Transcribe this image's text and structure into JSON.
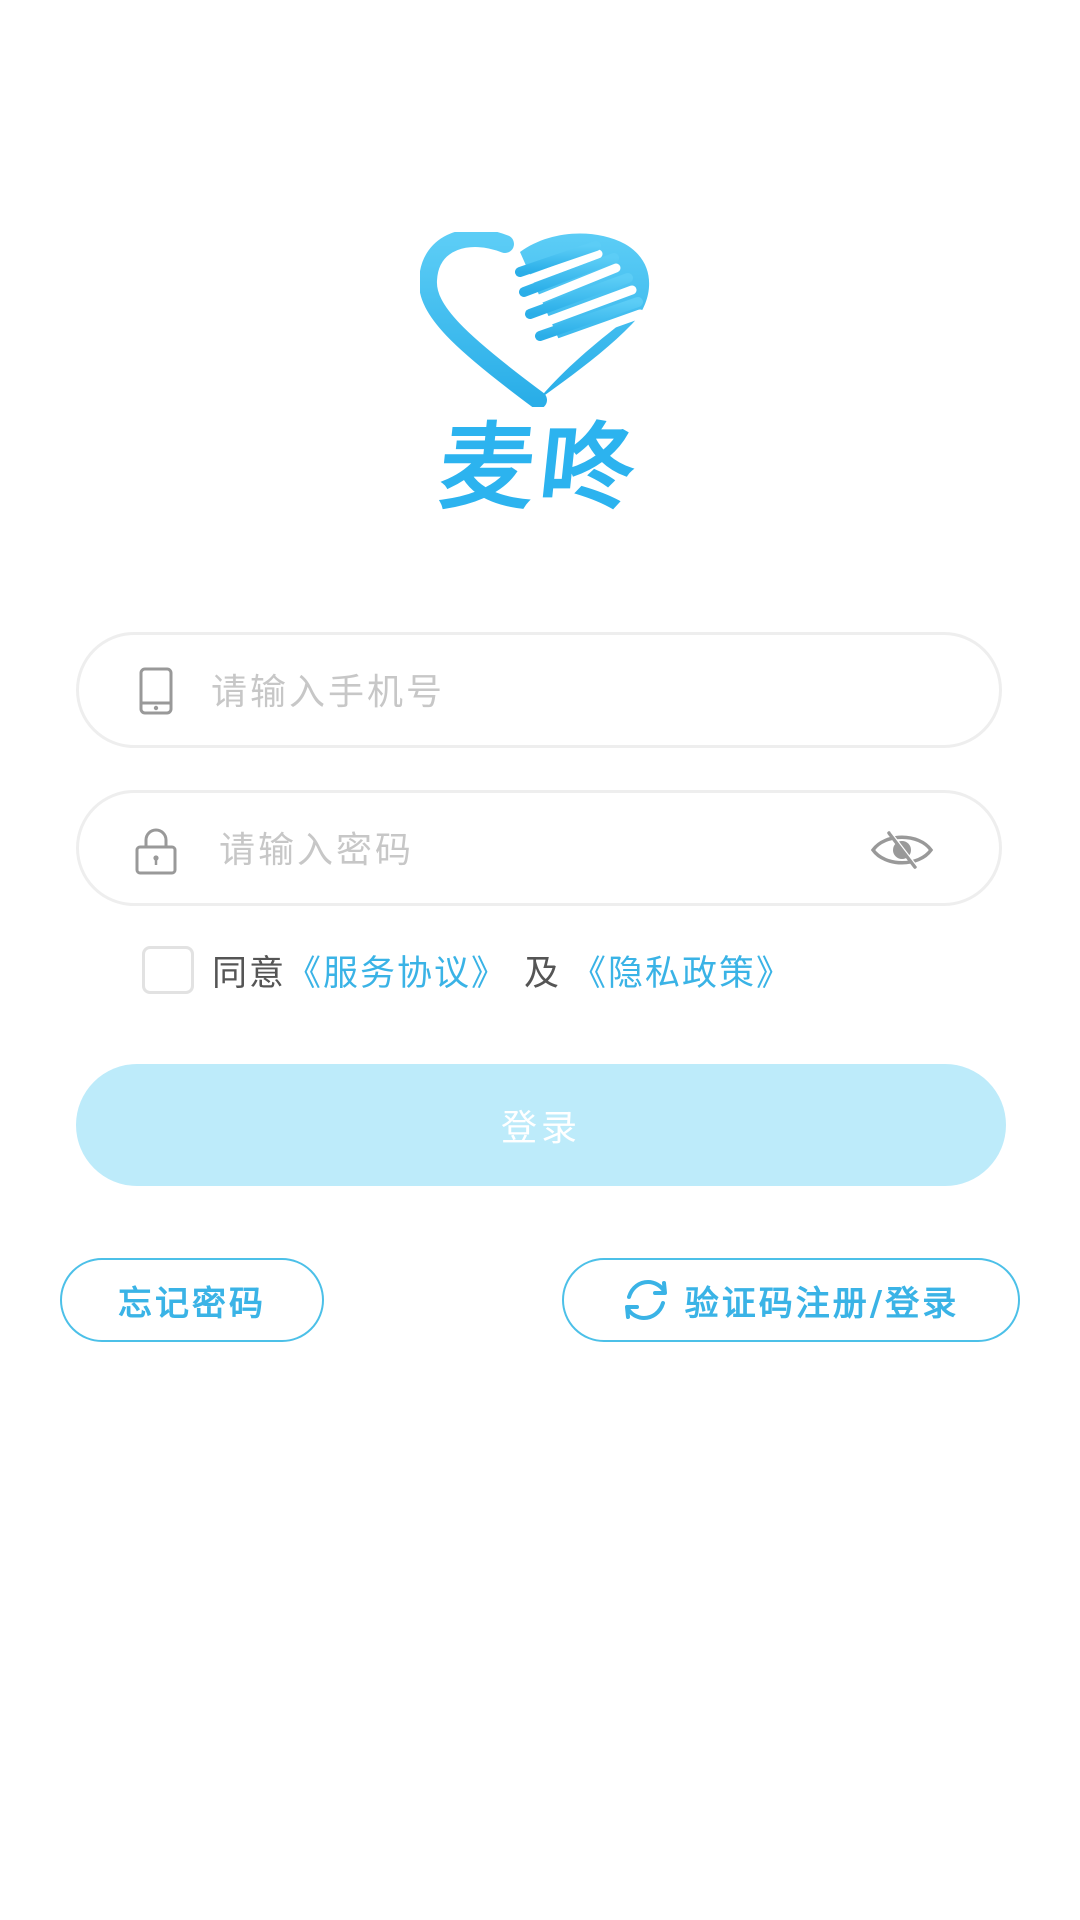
{
  "brand": {
    "name": "麦咚",
    "colors": {
      "primary": "#2cb3ef",
      "light": "#5ccdf6",
      "button_disabled": "#bdebfa"
    }
  },
  "phone_field": {
    "icon": "phone-icon",
    "placeholder": "请输入手机号",
    "value": ""
  },
  "password_field": {
    "icon": "lock-icon",
    "placeholder": "请输入密码",
    "value": "",
    "toggle_icon": "eye-hidden-icon"
  },
  "agreement": {
    "checked": false,
    "prefix": "同意",
    "service_link": "《服务协议》",
    "and": "及",
    "privacy_link": "《隐私政策》"
  },
  "login_button": {
    "label": "登录"
  },
  "forgot_button": {
    "label": "忘记密码"
  },
  "sms_button": {
    "icon": "refresh-icon",
    "label": "验证码注册/登录"
  }
}
